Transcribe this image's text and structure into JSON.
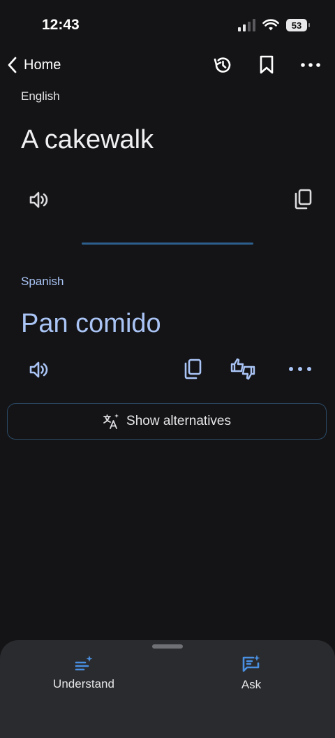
{
  "status_bar": {
    "time": "12:43",
    "battery": "53"
  },
  "header": {
    "back_label": "Home",
    "icons": [
      "history-icon",
      "bookmark-icon",
      "more-icon"
    ]
  },
  "source": {
    "language": "English",
    "text": "A cakewalk"
  },
  "target": {
    "language": "Spanish",
    "text": "Pan comido"
  },
  "alternatives_button": {
    "label": "Show alternatives"
  },
  "bottom_sheet": {
    "items": [
      {
        "label": "Understand",
        "icon": "understand-icon"
      },
      {
        "label": "Ask",
        "icon": "ask-icon"
      }
    ]
  },
  "colors": {
    "background": "#141416",
    "accent_text": "#a9c4f5",
    "accent_icon": "#4a90e2",
    "sheet": "#2a2b2e"
  }
}
